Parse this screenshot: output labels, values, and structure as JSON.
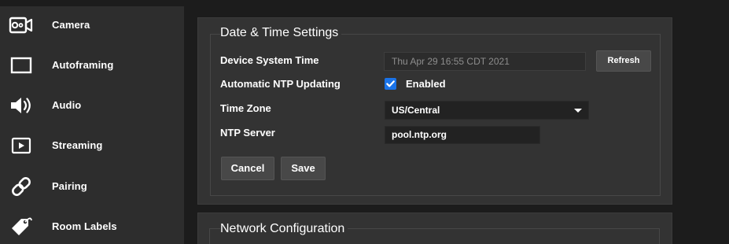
{
  "sidebar": {
    "items": [
      {
        "label": "Camera",
        "icon": "camera-icon"
      },
      {
        "label": "Autoframing",
        "icon": "frame-icon"
      },
      {
        "label": "Audio",
        "icon": "speaker-icon"
      },
      {
        "label": "Streaming",
        "icon": "play-icon"
      },
      {
        "label": "Pairing",
        "icon": "link-icon"
      },
      {
        "label": "Room Labels",
        "icon": "tag-icon"
      }
    ]
  },
  "date_time": {
    "title": "Date & Time Settings",
    "device_time_label": "Device System Time",
    "device_time_value": "Thu Apr 29 16:55 CDT 2021",
    "refresh_label": "Refresh",
    "ntp_updating_label": "Automatic NTP Updating",
    "ntp_updating_checked": true,
    "ntp_updating_option": "Enabled",
    "time_zone_label": "Time Zone",
    "time_zone_value": "US/Central",
    "ntp_server_label": "NTP Server",
    "ntp_server_value": "pool.ntp.org",
    "cancel_label": "Cancel",
    "save_label": "Save"
  },
  "network": {
    "title": "Network Configuration"
  },
  "colors": {
    "accent": "#1a73e8",
    "panel": "#333333",
    "sidebar": "#2d2d2d",
    "background": "#1c1c1c"
  }
}
